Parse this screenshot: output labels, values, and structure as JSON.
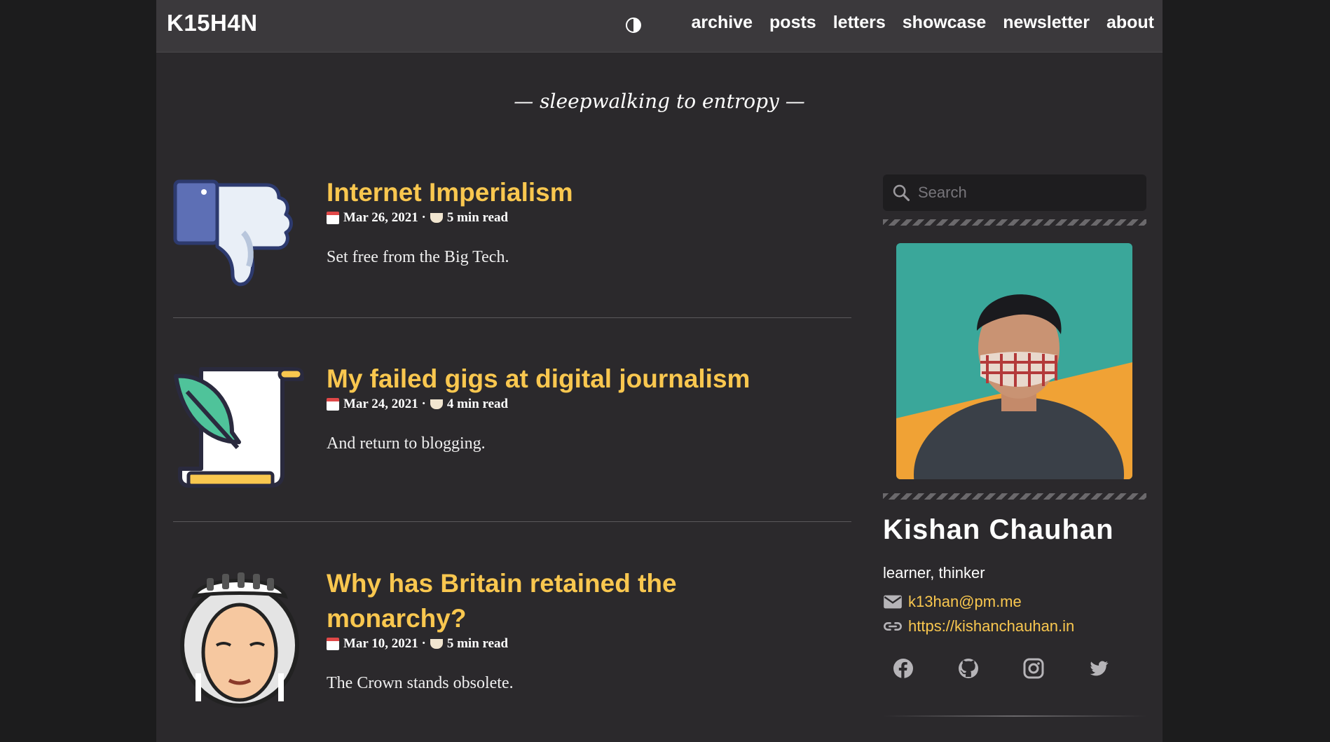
{
  "site": {
    "logo": "K15H4N",
    "tagline": "— sleepwalking to entropy —"
  },
  "nav": {
    "items": [
      "archive",
      "posts",
      "letters",
      "showcase",
      "newsletter",
      "about"
    ]
  },
  "posts": [
    {
      "title": "Internet Imperialism",
      "date": "Mar 26, 2021 ·",
      "read_time": "5 min read",
      "summary": "Set free from the Big Tech.",
      "icon": "thumbs-down-icon"
    },
    {
      "title": "My failed gigs at digital journalism",
      "date": "Mar 24, 2021 ·",
      "read_time": "4 min read",
      "summary": "And return to blogging.",
      "icon": "quill-scroll-icon"
    },
    {
      "title": "Why has Britain retained the monarchy?",
      "date": "Mar 10, 2021 ·",
      "read_time": "5 min read",
      "summary": "The Crown stands obsolete.",
      "icon": "queen-icon"
    }
  ],
  "sidebar": {
    "search_placeholder": "Search",
    "name": "Kishan Chauhan",
    "bio": "learner, thinker",
    "email": "k13han@pm.me",
    "website": "https://kishanchauhan.in",
    "socials": [
      "facebook-icon",
      "github-icon",
      "instagram-icon",
      "twitter-icon"
    ]
  },
  "colors": {
    "accent": "#f9c74f",
    "background": "#2b292c",
    "topbar": "#3b393c"
  }
}
